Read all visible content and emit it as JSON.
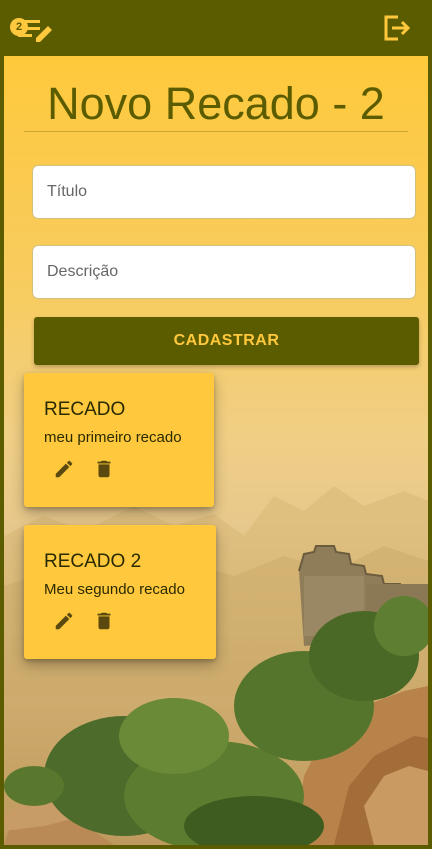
{
  "topbar": {
    "notes_badge": "2",
    "icons": {
      "notes": "edit-notes-icon",
      "logout": "logout-icon"
    }
  },
  "page": {
    "title": "Novo Recado - 2"
  },
  "form": {
    "titulo_placeholder": "Título",
    "descricao_placeholder": "Descrição",
    "submit_label": "CADASTRAR"
  },
  "recados": [
    {
      "title": "RECADO",
      "description": "meu primeiro recado"
    },
    {
      "title": "RECADO 2",
      "description": "Meu segundo recado"
    }
  ],
  "colors": {
    "olive": "#5b5c00",
    "amber": "#ffc83d"
  }
}
